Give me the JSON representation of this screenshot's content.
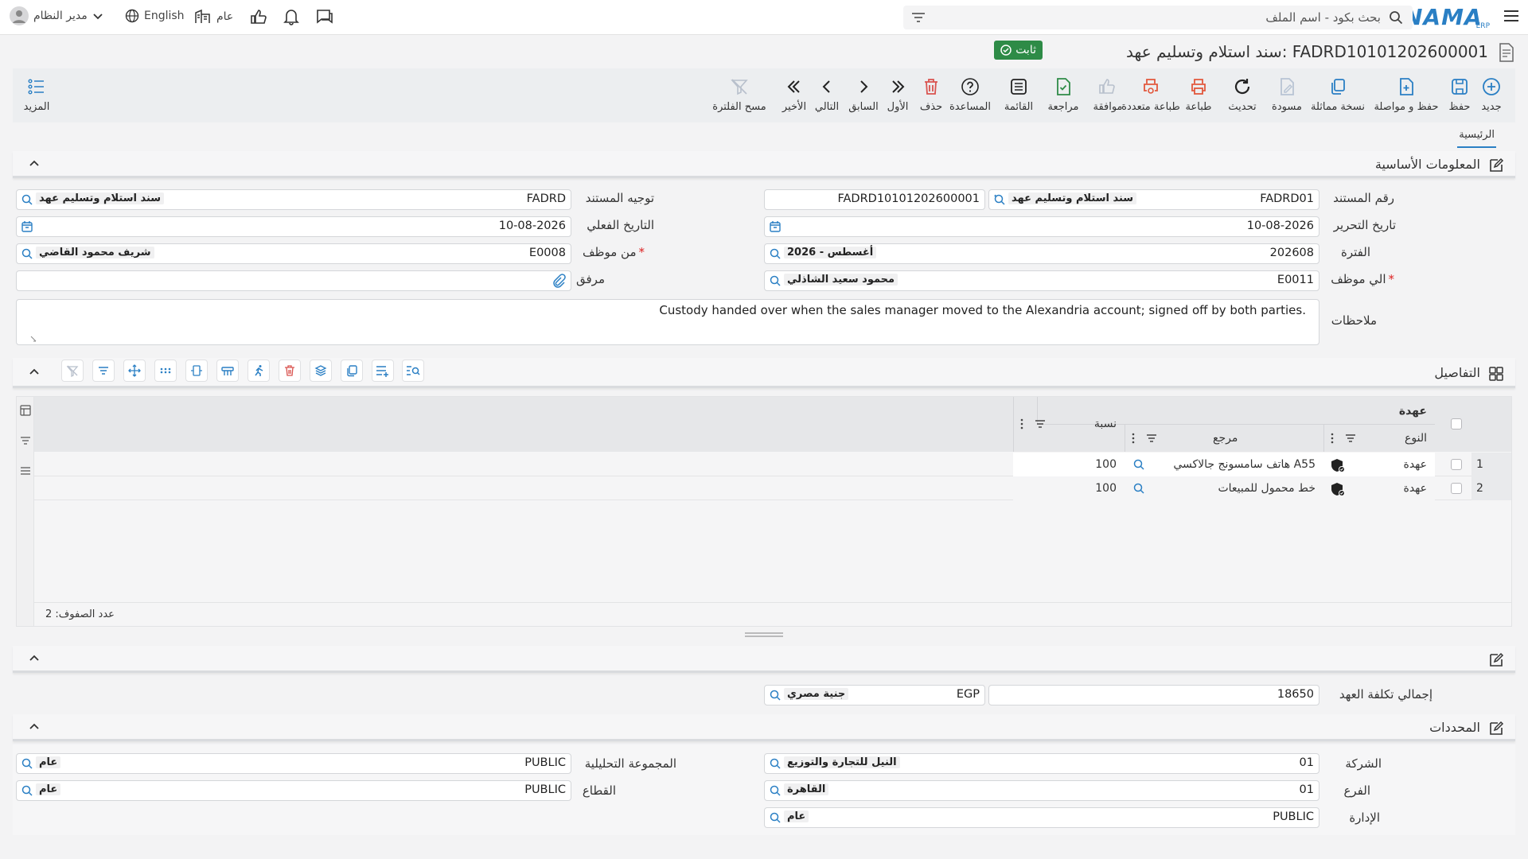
{
  "app": {
    "logo": "NAMA",
    "logo_sub": "ERP"
  },
  "topbar": {
    "search_placeholder": "بحث بكود - اسم الملف",
    "user_name": "مدير النظام",
    "language": "English",
    "scope": "عام"
  },
  "document": {
    "title": "سند استلام وتسليم عهد: FADRD10101202600001",
    "status": "ثابت"
  },
  "toolbar": {
    "new": "جديد",
    "save": "حفظ",
    "save_continue": "حفظ و مواصلة",
    "copy": "نسخة مماثلة",
    "draft": "مسودة",
    "refresh": "تحديث",
    "print": "طباعة",
    "multi_print": "طباعة متعددة",
    "approve": "موافقة",
    "review": "مراجعة",
    "list": "القائمة",
    "help": "المساعدة",
    "delete": "حذف",
    "first": "الأول",
    "prev": "السابق",
    "next": "التالي",
    "last": "الأخير",
    "clear_filter": "مسح الفلترة",
    "more": "المزيد"
  },
  "tabs": {
    "main": "الرئيسية"
  },
  "basic_info": {
    "title": "المعلومات الأساسية",
    "doc_no_label": "رقم المستند",
    "doc_no_code": "FADRD01",
    "doc_no_name": "سند استلام وتسليم عهد",
    "doc_serial": "FADRD10101202600001",
    "direction_label": "توجيه المستند",
    "direction_code": "FADRD",
    "direction_name": "سند استلام وتسليم عهد",
    "edit_date_label": "تاريخ التحرير",
    "edit_date": "10-08-2026",
    "actual_date_label": "التاريخ الفعلي",
    "actual_date": "10-08-2026",
    "period_label": "الفترة",
    "period_code": "202608",
    "period_name": "2026 - أغسطس",
    "from_emp_label": "من موظف",
    "from_emp_code": "E0008",
    "from_emp_name": "شريف محمود القاضي",
    "to_emp_label": "الي موظف",
    "to_emp_code": "E0011",
    "to_emp_name": "محمود سعيد الشاذلي",
    "attachment_label": "مرفق",
    "notes_label": "ملاحظات",
    "notes": "Custody handed over when the sales manager moved to the Alexandria account; signed off by both parties."
  },
  "details": {
    "title": "التفاصيل",
    "group_header": "عهدة",
    "col_type": "النوع",
    "col_ref": "مرجع",
    "col_pct": "نسبة",
    "rows": [
      {
        "no": "1",
        "type": "عهدة",
        "ref": "هاتف سامسونج جالاكسي A55",
        "pct": "100"
      },
      {
        "no": "2",
        "type": "عهدة",
        "ref": "خط محمول للمبيعات",
        "pct": "100"
      }
    ],
    "row_count": "عدد الصفوف: 2"
  },
  "totals": {
    "total_label": "إجمالي تكلفة العهد",
    "total_value": "18650",
    "currency_code": "EGP",
    "currency_name": "جنية مصري"
  },
  "dimensions": {
    "title": "المحددات",
    "company_label": "الشركة",
    "company_code": "01",
    "company_name": "النيل للتجارة والتوزيع",
    "branch_label": "الفرع",
    "branch_code": "01",
    "branch_name": "القاهرة",
    "dept_label": "الإدارة",
    "dept_code": "PUBLIC",
    "dept_name": "عام",
    "analysis_label": "المجموعة التحليلية",
    "analysis_code": "PUBLIC",
    "analysis_name": "عام",
    "sector_label": "القطاع",
    "sector_code": "PUBLIC",
    "sector_name": "عام"
  },
  "colors": {
    "accent": "#2a7fc4",
    "status_green": "#2e8b47",
    "danger": "#d9534f"
  }
}
